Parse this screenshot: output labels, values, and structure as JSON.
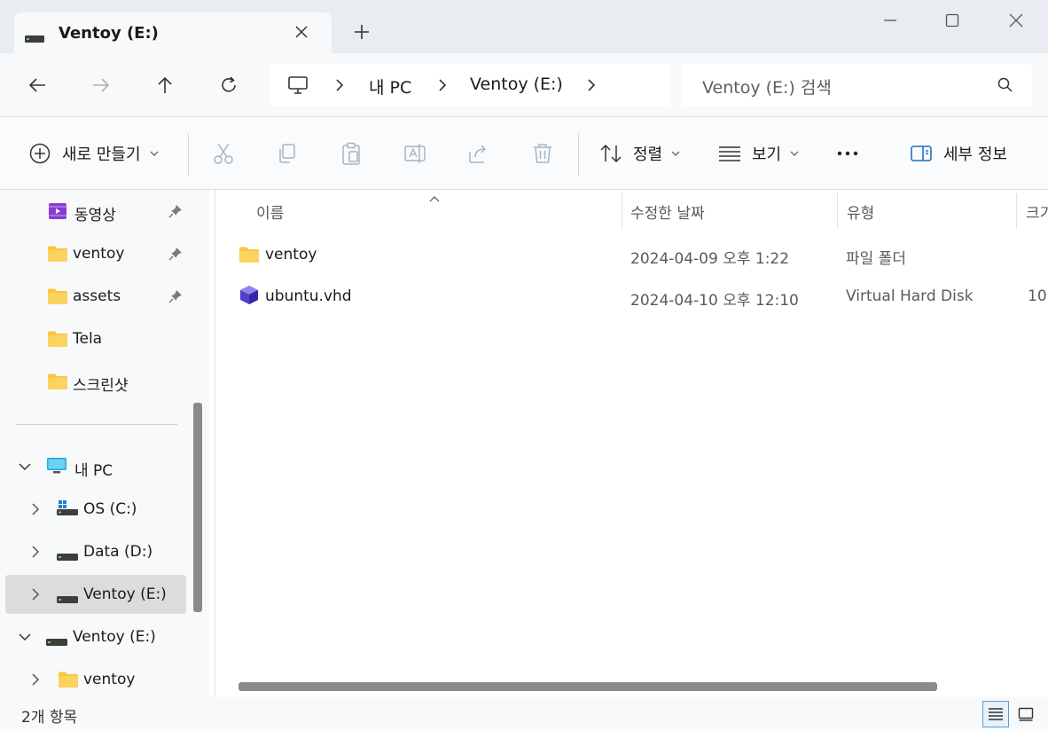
{
  "tab": {
    "title": "Ventoy (E:)"
  },
  "address": {
    "crumbs": [
      "내 PC",
      "Ventoy (E:)"
    ]
  },
  "search": {
    "placeholder": "Ventoy (E:) 검색"
  },
  "commandbar": {
    "new_label": "새로 만들기",
    "sort_label": "정렬",
    "view_label": "보기",
    "details_label": "세부 정보"
  },
  "sidebar": {
    "quick_access": [
      {
        "label": "동영상",
        "icon": "videos-icon",
        "pinned": true
      },
      {
        "label": "ventoy",
        "icon": "folder-icon",
        "pinned": true
      },
      {
        "label": "assets",
        "icon": "folder-icon",
        "pinned": true
      },
      {
        "label": "Tela",
        "icon": "folder-icon",
        "pinned": false
      },
      {
        "label": "스크린샷",
        "icon": "folder-icon",
        "pinned": false
      }
    ],
    "this_pc": {
      "label": "내 PC",
      "expanded": true
    },
    "drives": [
      {
        "label": "OS (C:)",
        "icon": "windows-drive-icon"
      },
      {
        "label": "Data (D:)",
        "icon": "drive-icon"
      },
      {
        "label": "Ventoy (E:)",
        "icon": "drive-icon",
        "selected": true
      }
    ],
    "ventoy_root": {
      "label": "Ventoy (E:)",
      "expanded": true
    },
    "ventoy_children": [
      {
        "label": "ventoy",
        "icon": "folder-icon"
      }
    ]
  },
  "columns": {
    "name": "이름",
    "modified": "수정한 날짜",
    "type": "유형",
    "size": "크기"
  },
  "files": [
    {
      "name": "ventoy",
      "modified": "2024-04-09 오후 1:22",
      "type": "파일 폴더",
      "size": "",
      "icon": "folder-icon"
    },
    {
      "name": "ubuntu.vhd",
      "modified": "2024-04-10 오후 12:10",
      "type": "Virtual Hard Disk",
      "size": "10",
      "icon": "vhd-icon"
    }
  ],
  "status": {
    "item_count": "2개 항목"
  },
  "colors": {
    "folder": "#f8c640",
    "selected_bg": "#dcdcdc",
    "accent": "#5b9bd5"
  }
}
